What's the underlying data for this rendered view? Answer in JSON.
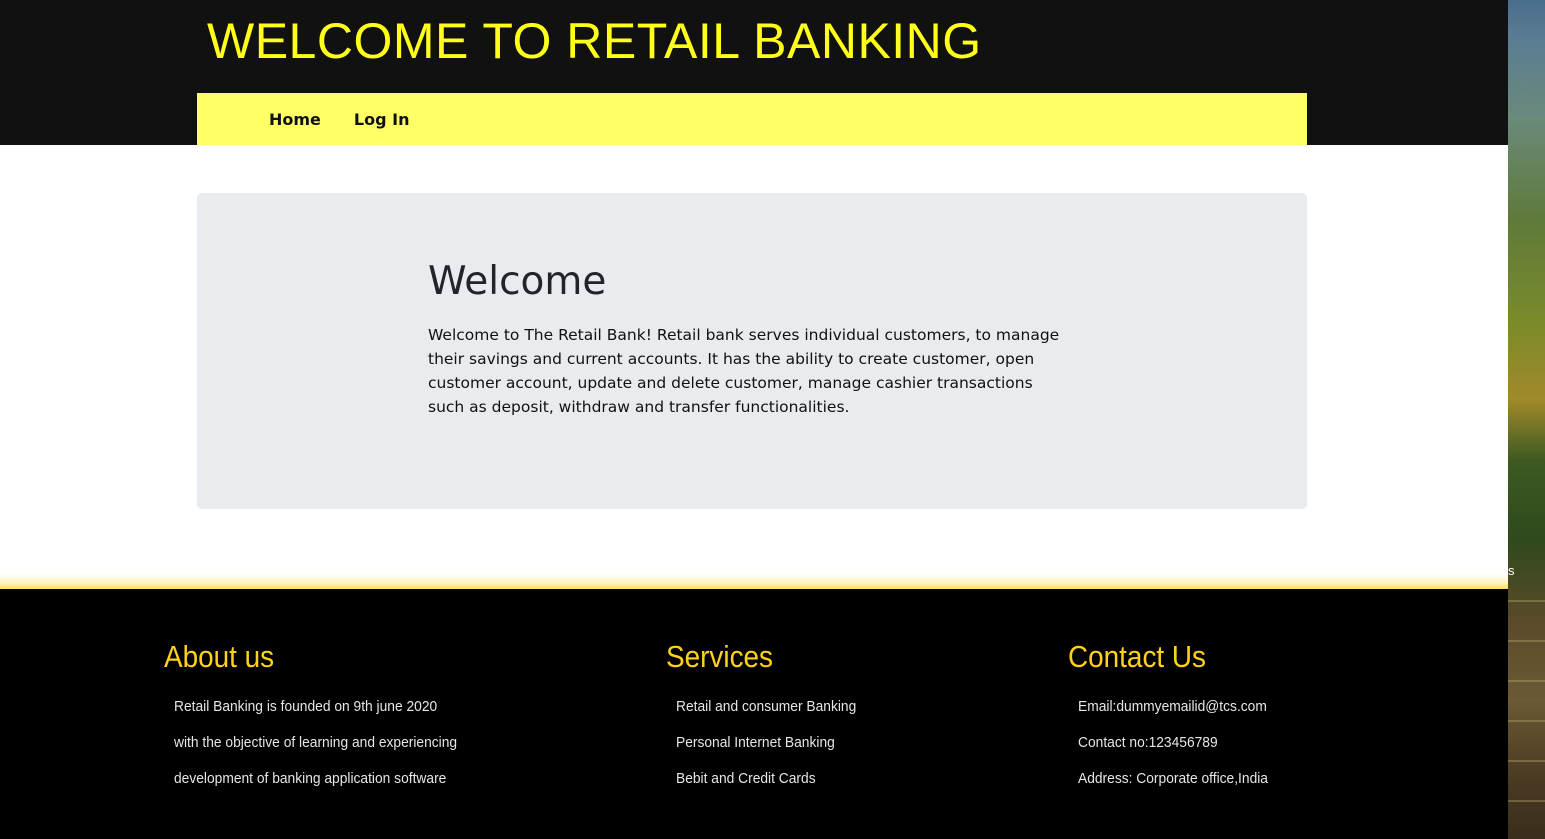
{
  "header": {
    "title": "WELCOME TO RETAIL BANKING",
    "nav": [
      {
        "label": "Home"
      },
      {
        "label": "Log In"
      }
    ]
  },
  "jumbotron": {
    "title": "Welcome",
    "text": "Welcome to The Retail Bank! Retail bank serves individual customers, to manage their savings and current accounts. It has the ability to create customer, open customer account, update and delete customer, manage cashier transactions such as deposit, withdraw and transfer functionalities."
  },
  "footer": {
    "about": {
      "heading": "About us",
      "lines": [
        "Retail Banking is founded on 9th june 2020",
        "with the objective of learning and experiencing",
        "development of banking application software"
      ]
    },
    "services": {
      "heading": "Services",
      "lines": [
        "Retail and consumer Banking",
        "Personal Internet Banking",
        "Bebit and Credit Cards"
      ]
    },
    "contact": {
      "heading": "Contact Us",
      "lines": [
        "Email:dummyemailid@tcs.com",
        "Contact no:123456789",
        "Address: Corporate office,India"
      ]
    }
  },
  "background": {
    "edge_text": "s"
  },
  "colors": {
    "title_yellow": "#ffff1a",
    "nav_yellow": "#ffff66",
    "footer_heading_gold": "#ffd21a",
    "header_bg": "#111111",
    "footer_bg": "#000000",
    "jumbotron_bg": "#e9ecef"
  }
}
